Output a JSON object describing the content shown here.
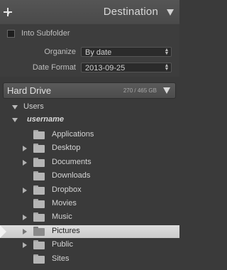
{
  "panel": {
    "title": "Destination"
  },
  "options": {
    "into_subfolder_label": "Into Subfolder",
    "organize_label": "Organize",
    "organize_value": "By date",
    "date_format_label": "Date Format",
    "date_format_value": "2013-09-25"
  },
  "drive": {
    "name": "Hard Drive",
    "size": "270 / 465 GB"
  },
  "tree": {
    "users_label": "Users",
    "user_label": "username",
    "folders": [
      {
        "label": "Applications",
        "expandable": false
      },
      {
        "label": "Desktop",
        "expandable": true
      },
      {
        "label": "Documents",
        "expandable": true
      },
      {
        "label": "Downloads",
        "expandable": false
      },
      {
        "label": "Dropbox",
        "expandable": true
      },
      {
        "label": "Movies",
        "expandable": false
      },
      {
        "label": "Music",
        "expandable": true
      },
      {
        "label": "Pictures",
        "expandable": true,
        "selected": true
      },
      {
        "label": "Public",
        "expandable": true
      },
      {
        "label": "Sites",
        "expandable": false
      }
    ]
  }
}
